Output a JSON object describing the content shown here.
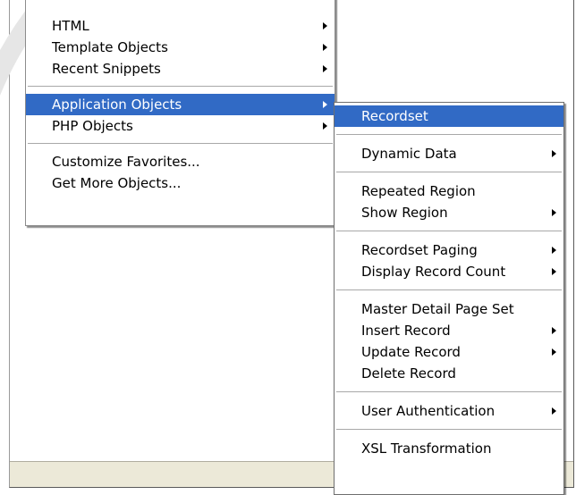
{
  "main_menu": {
    "items": [
      {
        "label": "HTML",
        "submenu": true
      },
      {
        "label": "Template Objects",
        "submenu": true
      },
      {
        "label": "Recent Snippets",
        "submenu": true
      },
      {
        "label": "Application Objects",
        "submenu": true,
        "selected": true
      },
      {
        "label": "PHP Objects",
        "submenu": true
      },
      {
        "label": "Customize Favorites...",
        "submenu": false
      },
      {
        "label": "Get More Objects...",
        "submenu": false
      }
    ]
  },
  "sub_menu": {
    "items": [
      {
        "label": "Recordset",
        "submenu": false,
        "selected": true
      },
      {
        "label": "Dynamic Data",
        "submenu": true
      },
      {
        "label": "Repeated Region",
        "submenu": false
      },
      {
        "label": "Show Region",
        "submenu": true
      },
      {
        "label": "Recordset Paging",
        "submenu": true
      },
      {
        "label": "Display Record Count",
        "submenu": true
      },
      {
        "label": "Master Detail Page Set",
        "submenu": false
      },
      {
        "label": "Insert Record",
        "submenu": true
      },
      {
        "label": "Update Record",
        "submenu": true
      },
      {
        "label": "Delete Record",
        "submenu": false
      },
      {
        "label": "User Authentication",
        "submenu": true
      },
      {
        "label": "XSL Transformation",
        "submenu": false
      }
    ]
  },
  "colors": {
    "selection": "#316ac5",
    "statusbar": "#ece9d8"
  }
}
